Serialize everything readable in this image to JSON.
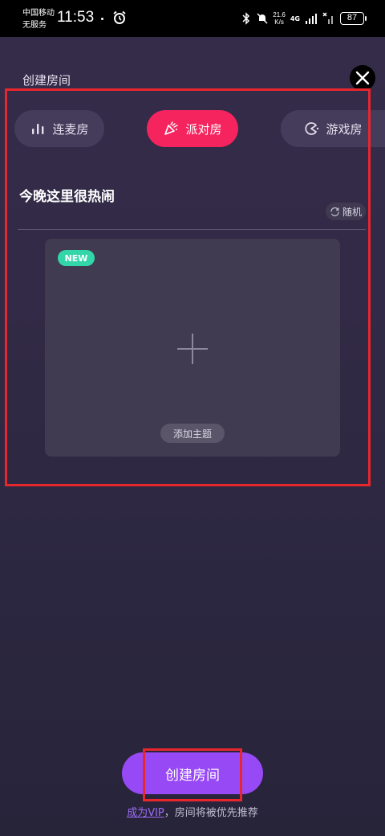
{
  "status_bar": {
    "carrier_line1": "中国移动",
    "carrier_line2": "无服务",
    "time": "11:53",
    "speed_value": "21.6",
    "speed_unit": "K/s",
    "network": "4G",
    "battery": "87"
  },
  "header": {
    "title": "创建房间"
  },
  "room_types": [
    {
      "label": "连麦房",
      "icon": "bar-chart-icon"
    },
    {
      "label": "派对房",
      "icon": "party-popper-icon"
    },
    {
      "label": "游戏房",
      "icon": "game-pacman-icon"
    }
  ],
  "room_name": {
    "value": "今晚这里很热闹",
    "random_label": "随机"
  },
  "theme": {
    "badge": "NEW",
    "add_label": "添加主题"
  },
  "footer": {
    "create_button": "创建房间",
    "vip_link": "成为VIP",
    "vip_note": "，房间将被优先推荐"
  },
  "colors": {
    "accent_pink": "#f5245f",
    "accent_purple": "#9849f6",
    "new_badge": "#33d6a9",
    "annotation_red": "#e8262d"
  }
}
